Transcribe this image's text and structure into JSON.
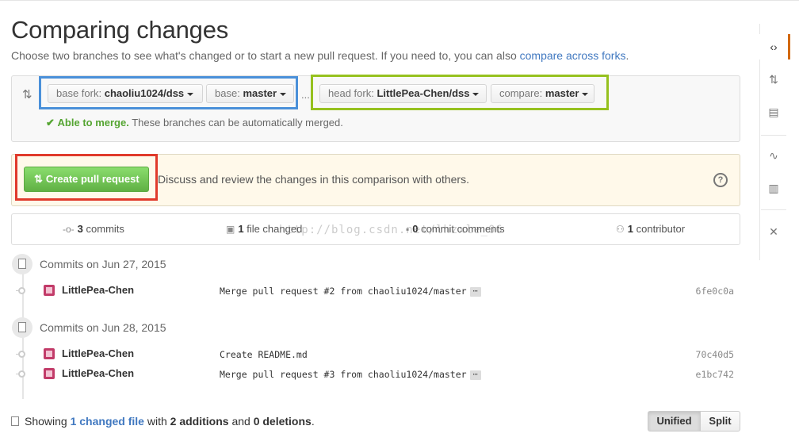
{
  "page": {
    "title": "Comparing changes",
    "subtitle": "Choose two branches to see what's changed or to start a new pull request. If you need to, you can also",
    "subtitle_link": "compare across forks",
    "subtitle_end": "."
  },
  "branches": {
    "base_fork_label": "base fork:",
    "base_fork_value": "chaoliu1024/dss",
    "base_label": "base:",
    "base_value": "master",
    "separator": "...",
    "head_fork_label": "head fork:",
    "head_fork_value": "LittlePea-Chen/dss",
    "compare_label": "compare:",
    "compare_value": "master",
    "merge_status": "Able to merge.",
    "merge_detail": "These branches can be automatically merged."
  },
  "pull_request": {
    "button_label": "Create pull request",
    "description": "Discuss and review the changes in this comparison with others.",
    "help_icon": "?"
  },
  "stats": {
    "commits_count": "3",
    "commits_label": "commits",
    "files_count": "1",
    "files_label": "file changed",
    "comments_count": "0",
    "comments_label": "commit comments",
    "contributors_count": "1",
    "contributors_label": "contributor"
  },
  "watermark": "http://blog.csdn.net/lhzxle_06",
  "commit_groups": [
    {
      "date_label": "Commits on Jun 27, 2015",
      "commits": [
        {
          "author": "LittlePea-Chen",
          "message": "Merge pull request #2 from chaoliu1024/master",
          "has_more": true,
          "sha": "6fe0c0a"
        }
      ]
    },
    {
      "date_label": "Commits on Jun 28, 2015",
      "commits": [
        {
          "author": "LittlePea-Chen",
          "message": "Create README.md",
          "has_more": false,
          "sha": "70c40d5"
        },
        {
          "author": "LittlePea-Chen",
          "message": "Merge pull request #3 from chaoliu1024/master",
          "has_more": true,
          "sha": "e1bc742"
        }
      ]
    }
  ],
  "footer": {
    "showing": "Showing",
    "changed_file": "1 changed file",
    "with": "with",
    "additions": "2 additions",
    "and": "and",
    "deletions": "0 deletions",
    "end": "."
  },
  "view_toggle": {
    "unified_label": "Unified",
    "split_label": "Split",
    "selected": "Unified"
  },
  "ellipsis_label": "⋯",
  "sidebar": {
    "items": [
      "code-icon",
      "pull-request-icon",
      "wiki-icon",
      "pulse-icon",
      "graphs-icon",
      "settings-icon"
    ],
    "selected": "code-icon"
  },
  "colors": {
    "link": "#4078c0",
    "merge_ok": "#55a532",
    "pr_button": "#60b044",
    "highlight_blue": "#4a90d9",
    "highlight_green": "#96c11f",
    "highlight_red": "#e03a2b"
  }
}
